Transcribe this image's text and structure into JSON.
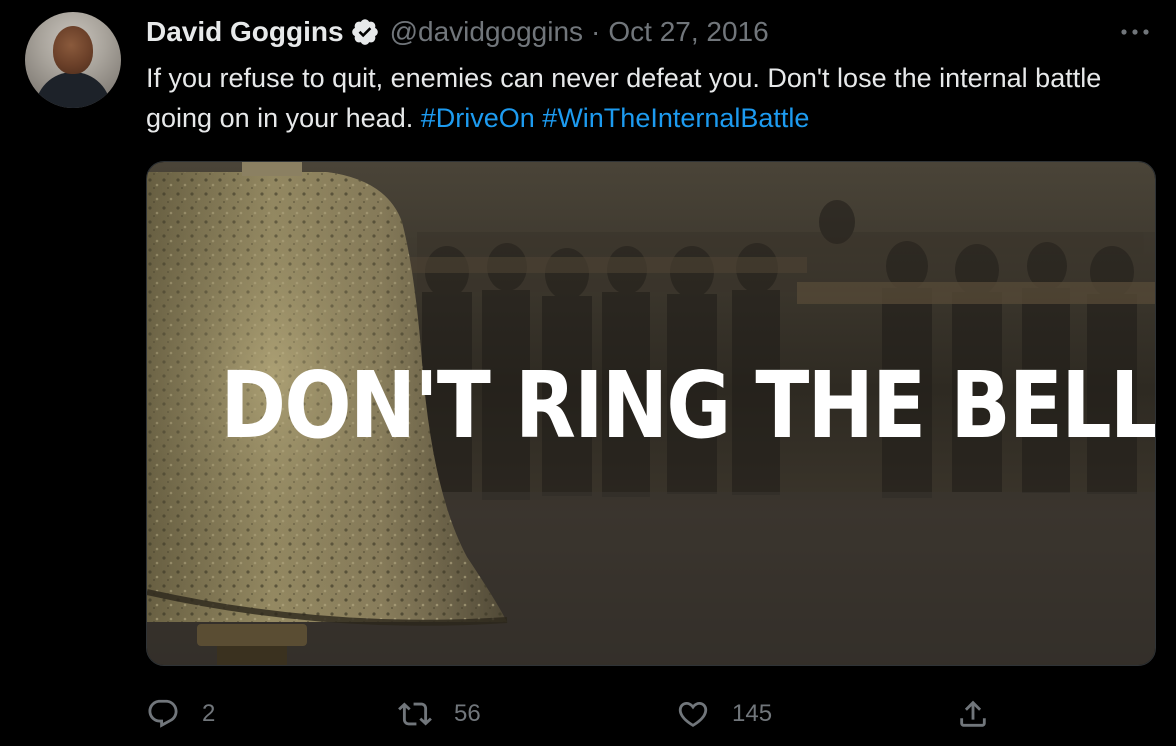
{
  "tweet": {
    "display_name": "David Goggins",
    "handle": "@davidgoggins",
    "separator": "·",
    "date": "Oct 27, 2016",
    "text_plain": "If you refuse to quit, enemies can never defeat you. Don't lose the internal battle going on in your head.",
    "hashtags": [
      "#DriveOn",
      "#WinTheInternalBattle"
    ],
    "media_overlay_text": "DON'T RING THE BELL"
  },
  "actions": {
    "reply_count": "2",
    "retweet_count": "56",
    "like_count": "145"
  },
  "icons": {
    "verified": "verified-badge-icon",
    "more": "more-horizontal-icon",
    "reply": "reply-icon",
    "retweet": "retweet-icon",
    "like": "heart-icon",
    "share": "share-icon"
  },
  "colors": {
    "background": "#000000",
    "text": "#e7e9ea",
    "secondary": "#71767b",
    "link": "#1d9bf0"
  }
}
